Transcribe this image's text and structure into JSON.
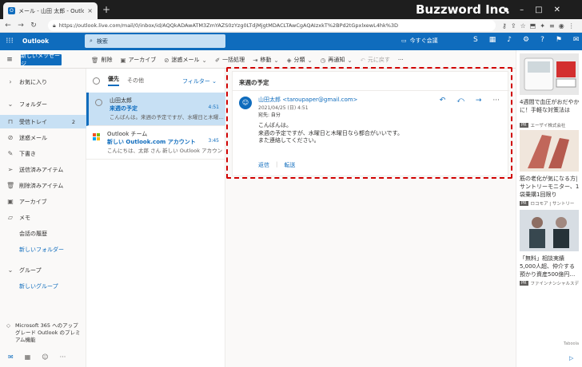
{
  "browser": {
    "tab_title": "メール - 山田 太郎 - Outlook",
    "tab_close": "×",
    "new_tab": "+",
    "url": "https://outlook.live.com/mail/0/inbox/id/AQQkADAwATM3ZmYAZS0zYzg0LTdjMjgtMDACLTAwCgAQAIzxkT%2BPd2tGpxlxewL4hk%3D",
    "brand_overlay": "Buzzword Inc."
  },
  "outlook": {
    "app_name": "Outlook",
    "search_placeholder": "検索",
    "meet_now": "今すぐ会議"
  },
  "toolbar": {
    "new_message": "新しいメッセージ",
    "actions": [
      {
        "label": "削除",
        "icon": "trash-icon"
      },
      {
        "label": "アーカイブ",
        "icon": "archive-icon"
      },
      {
        "label": "迷惑メール",
        "icon": "junk-icon",
        "dropdown": true
      },
      {
        "label": "一括処理",
        "icon": "sweep-icon"
      },
      {
        "label": "移動",
        "icon": "move-icon",
        "dropdown": true
      },
      {
        "label": "分類",
        "icon": "tag-icon",
        "dropdown": true
      },
      {
        "label": "再通知",
        "icon": "clock-icon",
        "dropdown": true
      },
      {
        "label": "元に戻す",
        "icon": "undo-icon",
        "disabled": true
      }
    ],
    "more": "···"
  },
  "nav": {
    "favorites": "お気に入り",
    "folders": "フォルダー",
    "items": [
      {
        "label": "受信トレイ",
        "count": "2",
        "selected": true
      },
      {
        "label": "迷惑メール"
      },
      {
        "label": "下書き"
      },
      {
        "label": "送信済みアイテム"
      },
      {
        "label": "削除済みアイテム"
      },
      {
        "label": "アーカイブ"
      },
      {
        "label": "メモ"
      },
      {
        "label": "会話の履歴"
      }
    ],
    "new_folder": "新しいフォルダー",
    "groups": "グループ",
    "new_group": "新しいグループ",
    "promo": "Microsoft 365 へのアップグレード Outlook のプレミアム機能"
  },
  "list": {
    "tab_focused": "優先",
    "tab_other": "その他",
    "filter": "フィルター",
    "mails": [
      {
        "sender": "山田太郎",
        "subject": "来週の予定",
        "time": "4:51",
        "preview": "こんばんは。来週の予定ですが、水曜日と木曜…"
      },
      {
        "sender": "Outlook チーム",
        "subject": "新しい Outlook.com アカウントへようこそ",
        "time": "3:45",
        "preview": "こんにちは、太郎 さん 新しい Outlook アカウント…"
      }
    ]
  },
  "reading": {
    "subject": "来週の予定",
    "from": "山田太郎 <taroupaper@gmail.com>",
    "date": "2021/04/25 (日) 4:51",
    "to": "宛先: 自分",
    "body": [
      "こんばんは。",
      "来週の予定ですが、水曜日と木曜日なら都合がいいです。",
      "また連絡してください。"
    ],
    "reply": "返信",
    "forward": "転送"
  },
  "ads": [
    {
      "text": "4週間で血圧がおだやかに！手軽な対策法は",
      "source": "エーザイ株式会社"
    },
    {
      "text": "筋の老化が気になる方|サントリーモニター、1袋乗購1回限り",
      "source": "ロコモア | サントリー"
    },
    {
      "text": "「無料」相談実績5,000人超、仲介する預かり資産500億円…",
      "source": "ファインナンシャルスデ"
    }
  ],
  "ads_footer": "Taboola",
  "pr_tag": "PR",
  "colors": {
    "brand": "#0f6cbd",
    "selected": "#c7e0f4",
    "highlight_border": "#d00000"
  }
}
